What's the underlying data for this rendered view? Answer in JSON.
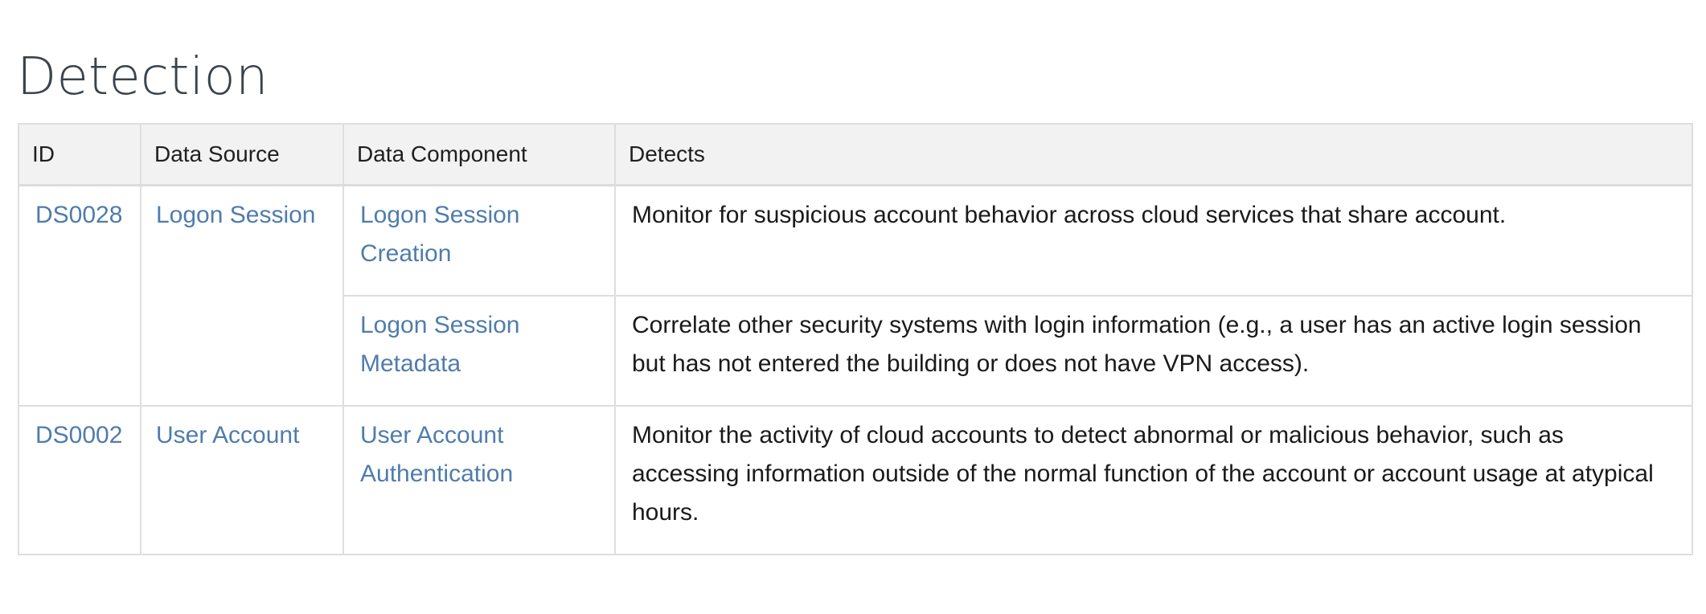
{
  "section": {
    "title": "Detection"
  },
  "table": {
    "headers": {
      "id": "ID",
      "data_source": "Data Source",
      "data_component": "Data Component",
      "detects": "Detects"
    },
    "rows": [
      {
        "id": "DS0028",
        "data_source": "Logon Session",
        "components": [
          {
            "name_line1": "Logon Session",
            "name_line2": "Creation",
            "detects": "Monitor for suspicious account behavior across cloud services that share account."
          },
          {
            "name_line1": "Logon Session",
            "name_line2": "Metadata",
            "detects": "Correlate other security systems with login information (e.g., a user has an active login session but has not entered the building or does not have VPN access)."
          }
        ]
      },
      {
        "id": "DS0002",
        "data_source": "User Account",
        "components": [
          {
            "name_line1": "User Account",
            "name_line2": "Authentication",
            "detects": "Monitor the activity of cloud accounts to detect abnormal or malicious behavior, such as accessing information outside of the normal function of the account or account usage at atypical hours."
          }
        ]
      }
    ]
  },
  "colors": {
    "link": "#4f7cac",
    "header_bg": "#f2f2f2",
    "border": "#dedede",
    "title": "#39434c"
  }
}
